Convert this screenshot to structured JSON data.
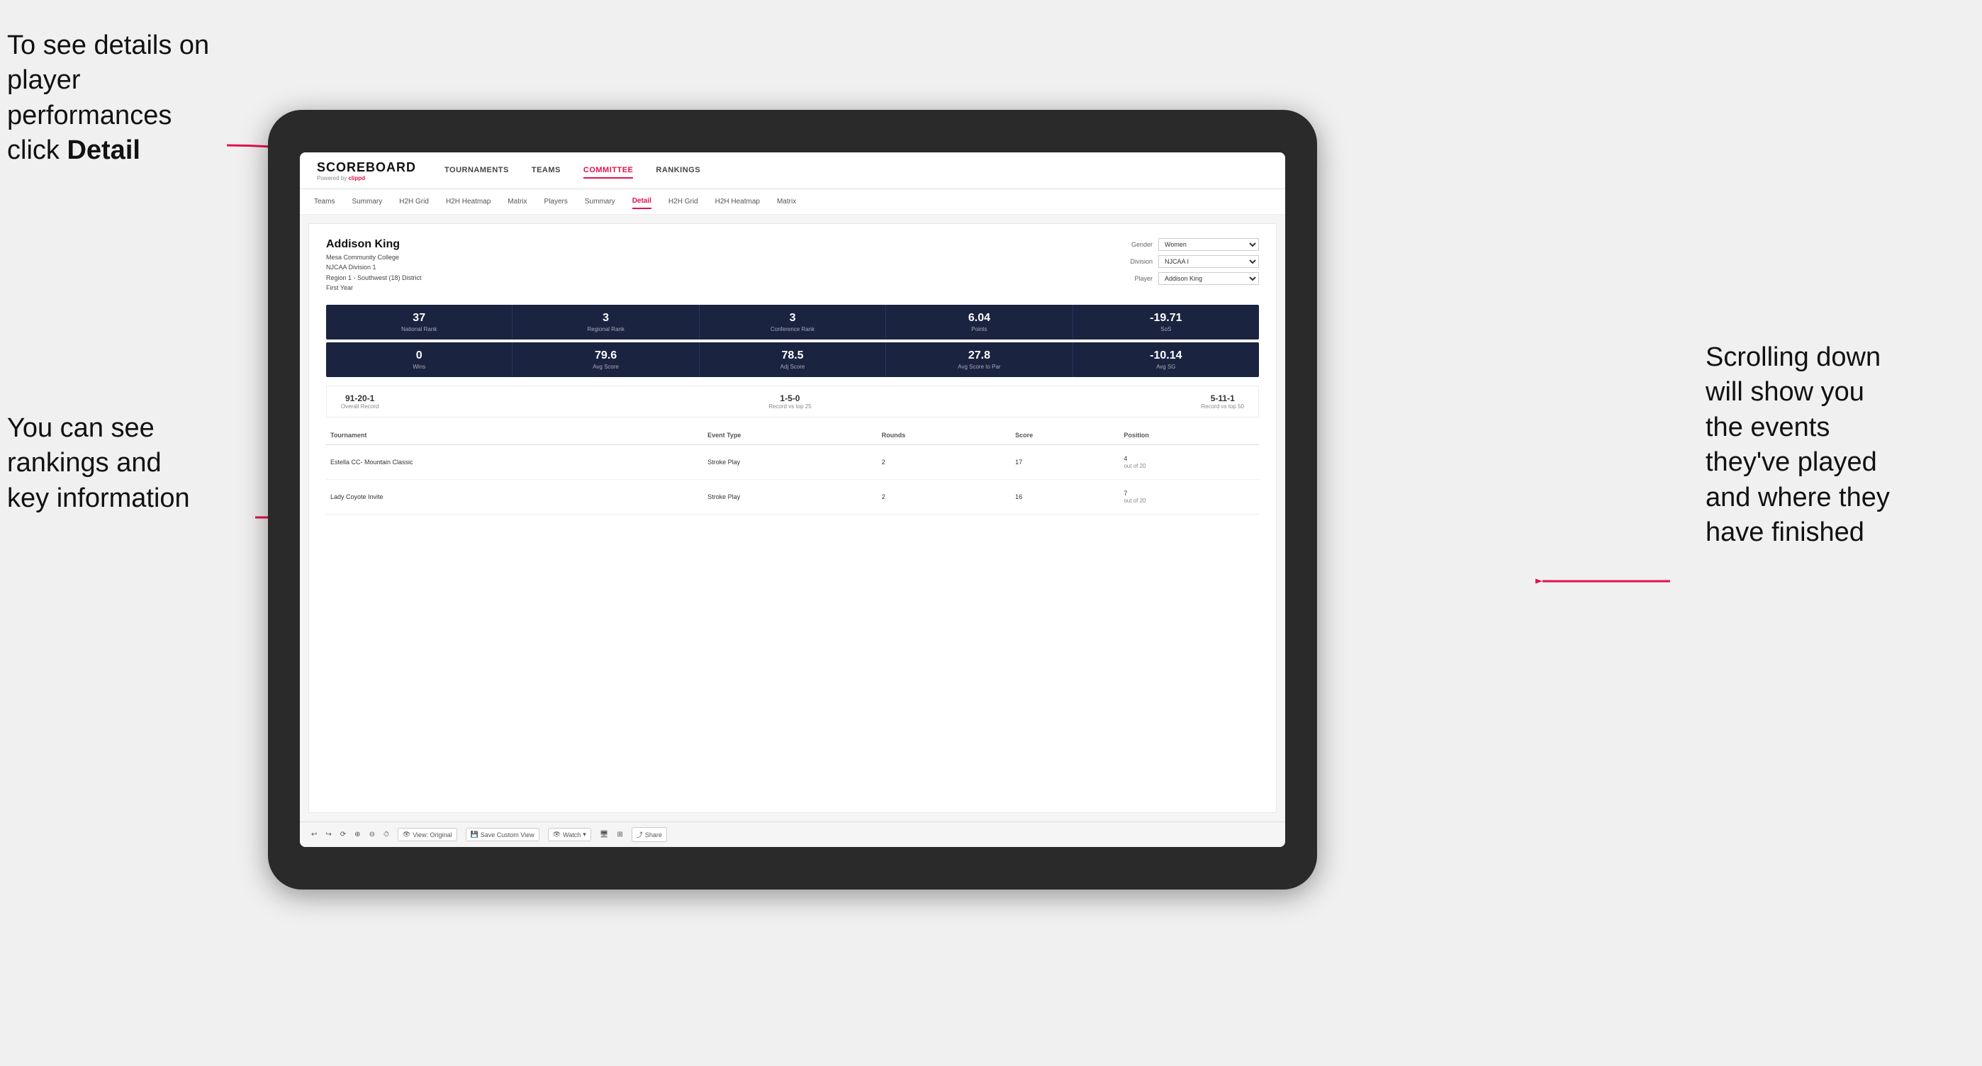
{
  "annotations": {
    "top_left": {
      "line1": "To see details on",
      "line2": "player performances",
      "line3_plain": "click ",
      "line3_bold": "Detail"
    },
    "bottom_left": {
      "line1": "You can see",
      "line2": "rankings and",
      "line3": "key information"
    },
    "right": {
      "line1": "Scrolling down",
      "line2": "will show you",
      "line3": "the events",
      "line4": "they've played",
      "line5": "and where they",
      "line6": "have finished"
    }
  },
  "nav": {
    "logo": "SCOREBOARD",
    "logo_sub": "Powered by ",
    "logo_brand": "clippd",
    "items": [
      {
        "label": "TOURNAMENTS"
      },
      {
        "label": "TEAMS"
      },
      {
        "label": "COMMITTEE"
      },
      {
        "label": "RANKINGS"
      }
    ]
  },
  "sub_nav": {
    "items": [
      {
        "label": "Teams"
      },
      {
        "label": "Summary"
      },
      {
        "label": "H2H Grid"
      },
      {
        "label": "H2H Heatmap"
      },
      {
        "label": "Matrix"
      },
      {
        "label": "Players"
      },
      {
        "label": "Summary"
      },
      {
        "label": "Detail"
      },
      {
        "label": "H2H Grid"
      },
      {
        "label": "H2H Heatmap"
      },
      {
        "label": "Matrix"
      }
    ],
    "active": "Detail"
  },
  "player": {
    "name": "Addison King",
    "college": "Mesa Community College",
    "division": "NJCAA Division 1",
    "region": "Region 1 - Southwest (18) District",
    "year": "First Year"
  },
  "controls": {
    "gender_label": "Gender",
    "gender_value": "Women",
    "division_label": "Division",
    "division_value": "NJCAA I",
    "player_label": "Player",
    "player_value": "Addison King"
  },
  "stats_row1": [
    {
      "value": "37",
      "label": "National Rank"
    },
    {
      "value": "3",
      "label": "Regional Rank"
    },
    {
      "value": "3",
      "label": "Conference Rank"
    },
    {
      "value": "6.04",
      "label": "Points"
    },
    {
      "value": "-19.71",
      "label": "SoS"
    }
  ],
  "stats_row2": [
    {
      "value": "0",
      "label": "Wins"
    },
    {
      "value": "79.6",
      "label": "Avg Score"
    },
    {
      "value": "78.5",
      "label": "Adj Score"
    },
    {
      "value": "27.8",
      "label": "Avg Score to Par"
    },
    {
      "value": "-10.14",
      "label": "Avg SG"
    }
  ],
  "records": [
    {
      "value": "91-20-1",
      "label": "Overall Record"
    },
    {
      "value": "1-5-0",
      "label": "Record vs top 25"
    },
    {
      "value": "5-11-1",
      "label": "Record vs top 50"
    }
  ],
  "table": {
    "headers": [
      "Tournament",
      "Event Type",
      "Rounds",
      "Score",
      "Position"
    ],
    "rows": [
      {
        "tournament": "Estella CC- Mountain Classic",
        "event_type": "Stroke Play",
        "rounds": "2",
        "score": "17",
        "position": "4\nout of 20"
      },
      {
        "tournament": "Lady Coyote Invite",
        "event_type": "Stroke Play",
        "rounds": "2",
        "score": "16",
        "position": "7\nout of 20"
      }
    ]
  },
  "toolbar": {
    "view_label": "View: Original",
    "save_label": "Save Custom View",
    "watch_label": "Watch",
    "share_label": "Share"
  }
}
